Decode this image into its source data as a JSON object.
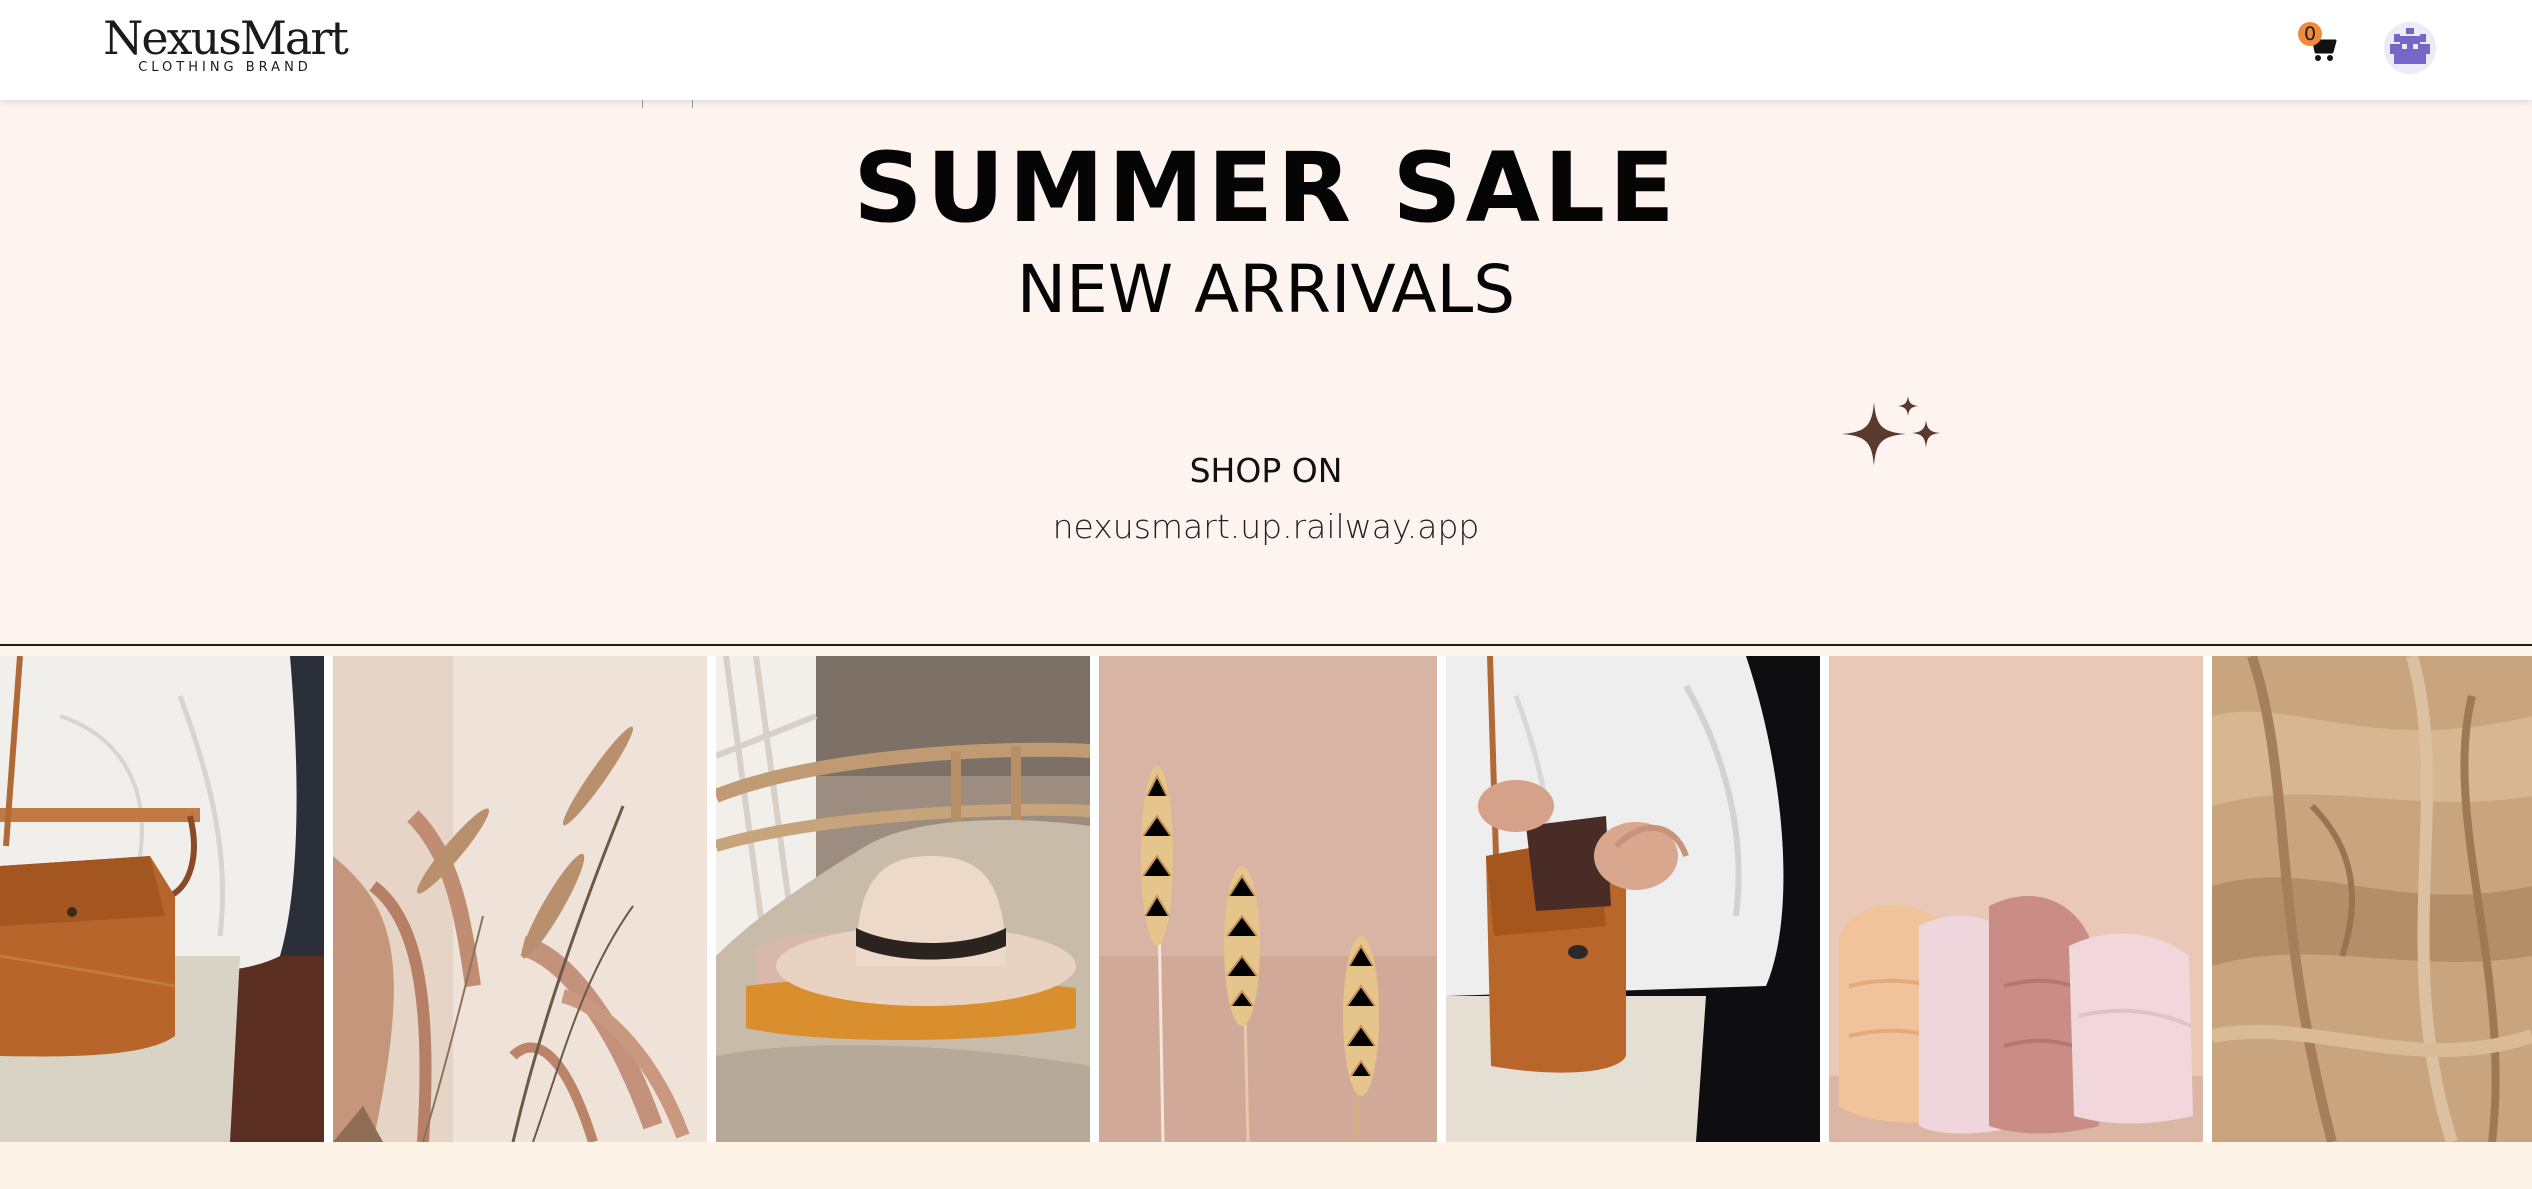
{
  "header": {
    "logo_text": "NexusMart",
    "logo_subtext": "CLOTHING BRAND",
    "cart_count": "0",
    "cart_icon": "shopping-cart-icon",
    "avatar_icon": "user-avatar-icon"
  },
  "banner": {
    "title": "SUMMER SALE",
    "subtitle": "NEW ARRIVALS",
    "shop_label": "SHOP ON",
    "shop_url": "nexusmart.up.railway.app",
    "sparkle_icon": "sparkle-icon"
  },
  "gallery": {
    "images": [
      "person with white shirt and brown leather shoulder bag",
      "dried grass stems with shadow on cream background",
      "cream felt hat on folded knits on rattan chair",
      "three dried wheat stalks on pink background",
      "person holding brown leather shoulder bag with wallet",
      "folded pastel knit garments stacked",
      "crumpled beige linen fabric"
    ]
  },
  "colors": {
    "banner_bg": "#fdf3ef",
    "accent_badge": "#ef8a3c",
    "sparkle": "#5a3a2e",
    "avatar": "#7566c8",
    "footer_bg": "#fdf3e7"
  }
}
